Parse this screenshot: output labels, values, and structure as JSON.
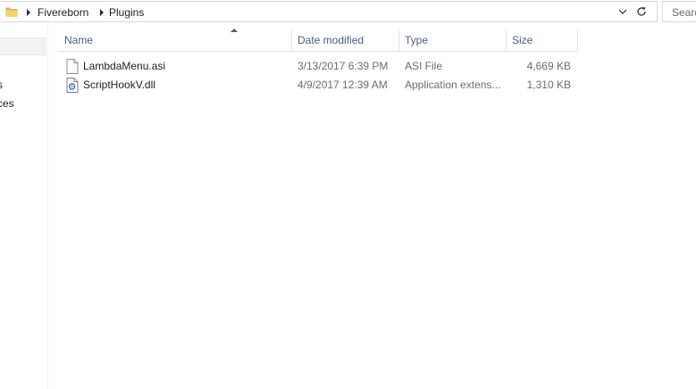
{
  "address_bar": {
    "breadcrumbs": [
      "Fivereborn",
      "Plugins"
    ]
  },
  "search": {
    "placeholder": "Search"
  },
  "nav_pane": {
    "items": [
      "s",
      "ces"
    ]
  },
  "file_list": {
    "columns": [
      "Name",
      "Date modified",
      "Type",
      "Size"
    ],
    "sort_column": "Name",
    "sort_direction": "ascending",
    "rows": [
      {
        "name": "LambdaMenu.asi",
        "date_modified": "3/13/2017 6:39 PM",
        "type": "ASI File",
        "size": "4,669 KB",
        "icon": "generic-file-icon"
      },
      {
        "name": "ScriptHookV.dll",
        "date_modified": "4/9/2017 12:39 AM",
        "type": "Application extens...",
        "size": "1,310 KB",
        "icon": "dll-file-icon"
      }
    ]
  },
  "colors": {
    "header_text": "#4c607a",
    "meta_text": "#6d6d6d",
    "folder_yellow": "#e8c252",
    "border": "#d9d9d9"
  }
}
